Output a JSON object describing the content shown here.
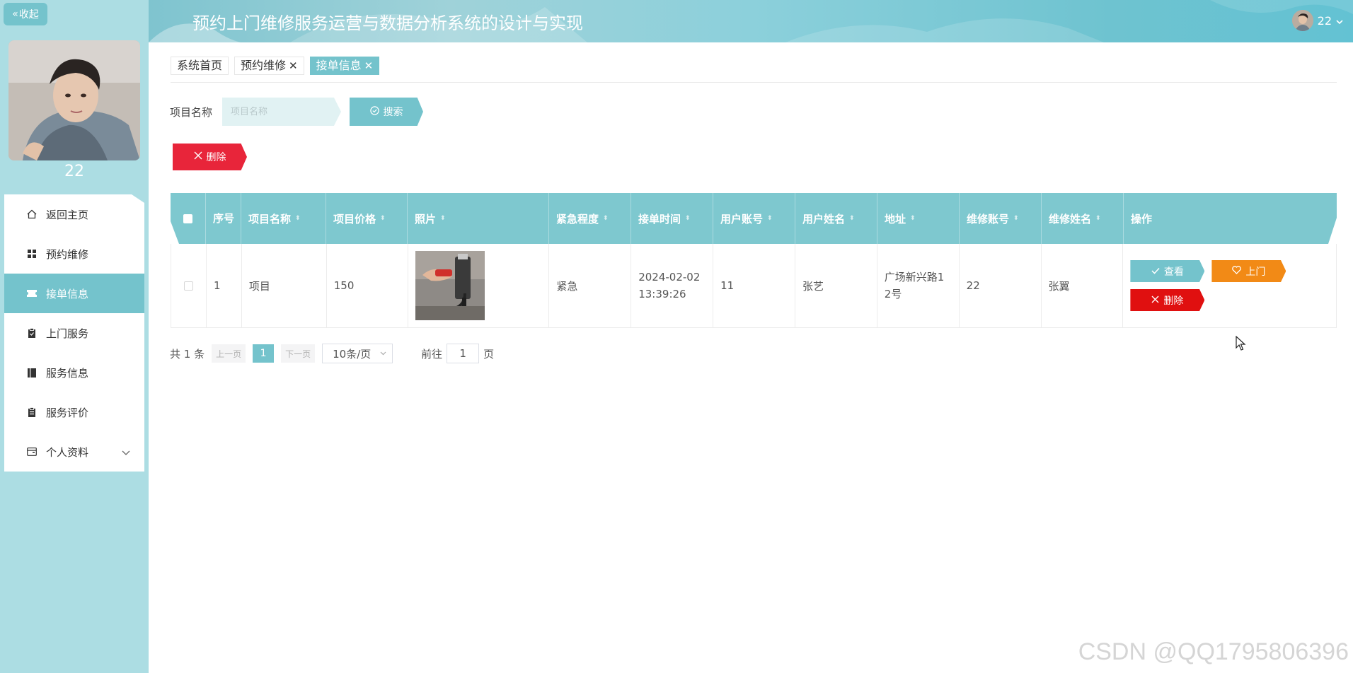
{
  "sidebar": {
    "collapse_label": "收起",
    "username": "22",
    "items": [
      {
        "label": "返回主页",
        "icon": "home-icon"
      },
      {
        "label": "预约维修",
        "icon": "grid-icon"
      },
      {
        "label": "接单信息",
        "icon": "ticket-icon",
        "active": true
      },
      {
        "label": "上门服务",
        "icon": "clipboard-icon"
      },
      {
        "label": "服务信息",
        "icon": "book-icon"
      },
      {
        "label": "服务评价",
        "icon": "clipboard-list-icon"
      },
      {
        "label": "个人资料",
        "icon": "wallet-icon",
        "expandable": true
      }
    ]
  },
  "header": {
    "title": "预约上门维修服务运营与数据分析系统的设计与实现",
    "username": "22"
  },
  "tabs": [
    {
      "label": "系统首页",
      "closable": false,
      "active": false
    },
    {
      "label": "预约维修",
      "closable": true,
      "active": false
    },
    {
      "label": "接单信息",
      "closable": true,
      "active": true
    }
  ],
  "search": {
    "label": "项目名称",
    "placeholder": "项目名称",
    "value": "",
    "button_label": "搜索"
  },
  "toolbar": {
    "delete_label": "删除"
  },
  "table": {
    "columns": [
      "",
      "序号",
      "项目名称",
      "项目价格",
      "照片",
      "紧急程度",
      "接单时间",
      "用户账号",
      "用户姓名",
      "地址",
      "维修账号",
      "维修姓名",
      "操作"
    ],
    "rows": [
      {
        "index": "1",
        "project_name": "项目",
        "price": "150",
        "urgency": "紧急",
        "time_line1": "2024-02-02",
        "time_line2": "13:39:26",
        "user_account": "11",
        "user_name": "张艺",
        "address_line1": "广场新兴路1",
        "address_line2": "2号",
        "repair_account": "22",
        "repair_name": "张翼",
        "actions": {
          "view": "查看",
          "visit": "上门",
          "delete": "删除"
        }
      }
    ]
  },
  "pagination": {
    "total_text": "共 1 条",
    "prev_label": "上一页",
    "current_page": "1",
    "next_label": "下一页",
    "page_size": "10条/页",
    "goto_prefix": "前往",
    "goto_value": "1",
    "goto_suffix": "页"
  },
  "watermark": "CSDN @QQ1795806396",
  "colors": {
    "accent": "#74c3cc",
    "sidebar_bg": "#acdde3",
    "danger": "#e8253a",
    "warning": "#f28a16"
  }
}
